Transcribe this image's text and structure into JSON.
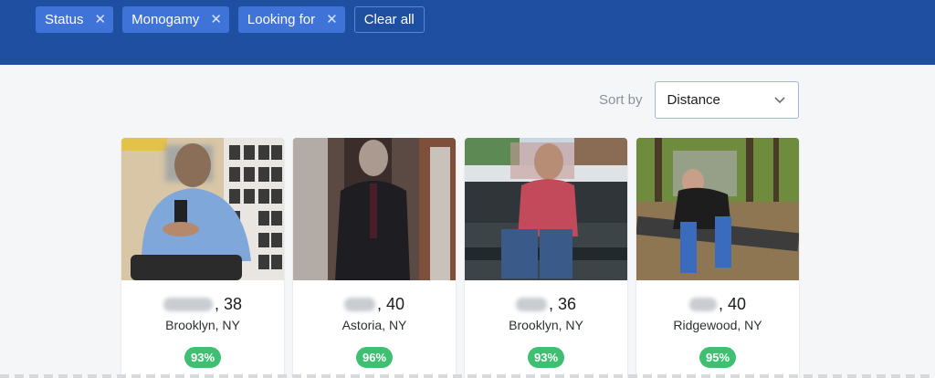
{
  "filters": [
    {
      "label": "Status",
      "remove_icon": "close-icon"
    },
    {
      "label": "Monogamy",
      "remove_icon": "close-icon"
    },
    {
      "label": "Looking for",
      "remove_icon": "close-icon"
    }
  ],
  "clear_all_label": "Clear all",
  "sort": {
    "label": "Sort by",
    "value": "Distance",
    "icon": "chevron-down-icon"
  },
  "colors": {
    "header": "#1f4fa0",
    "chip": "#3f73d8",
    "match_badge": "#3fbf72"
  },
  "profiles": [
    {
      "age": ", 38",
      "location": "Brooklyn, NY",
      "match": "93%"
    },
    {
      "age": ", 40",
      "location": "Astoria, NY",
      "match": "96%"
    },
    {
      "age": ", 36",
      "location": "Brooklyn, NY",
      "match": "93%"
    },
    {
      "age": ", 40",
      "location": "Ridgewood, NY",
      "match": "95%"
    }
  ]
}
